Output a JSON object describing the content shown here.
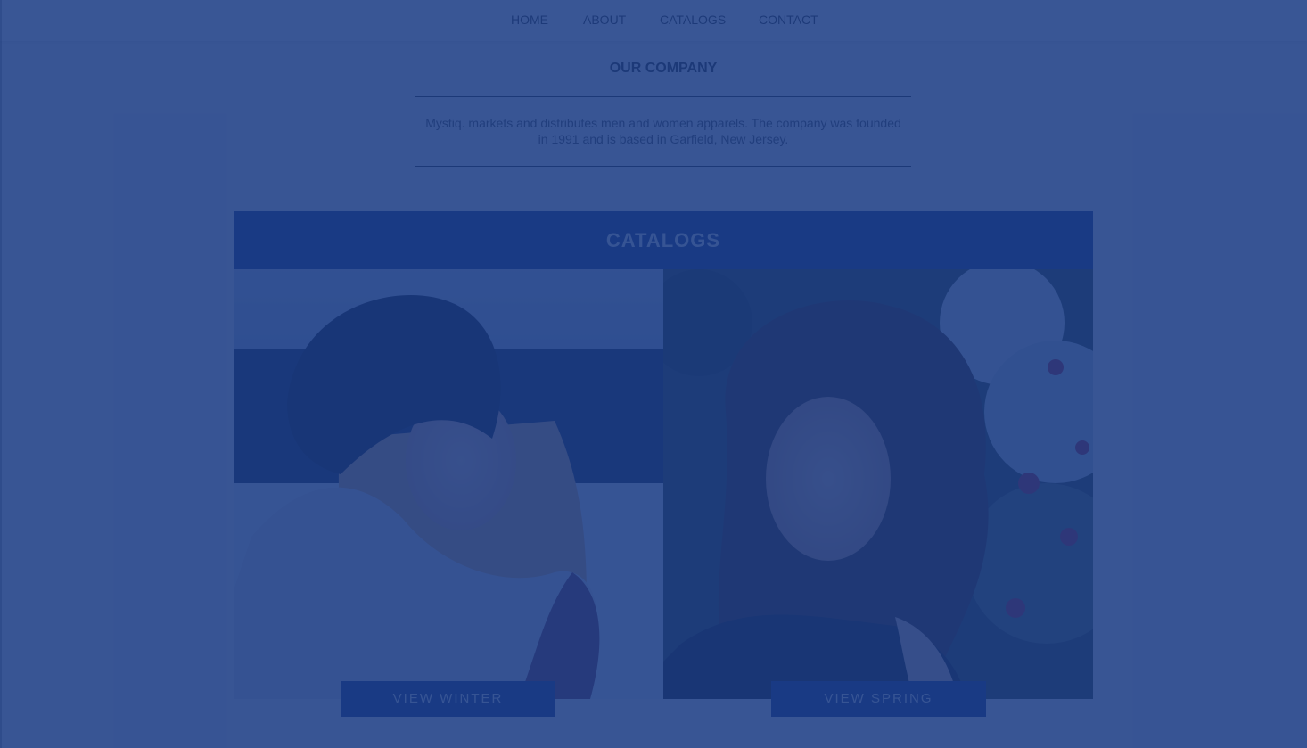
{
  "nav": {
    "items": [
      {
        "label": "HOME"
      },
      {
        "label": "ABOUT"
      },
      {
        "label": "CATALOGS"
      },
      {
        "label": "CONTACT"
      }
    ]
  },
  "company": {
    "title": "OUR COMPANY",
    "description": "Mystiq. markets and distributes men and women apparels. The company was founded in 1991 and is based in Garfield, New Jersey."
  },
  "catalogs": {
    "title": "CATALOGS",
    "cards": [
      {
        "button_label": "VIEW WINTER",
        "image": "woman-in-winter-beanie-photo"
      },
      {
        "button_label": "VIEW SPRING",
        "image": "woman-with-curly-hair-photo"
      }
    ]
  },
  "colors": {
    "overlay": "#183a84",
    "catalog_header": "#1e3d86",
    "page_background": "#f4f4f4"
  }
}
